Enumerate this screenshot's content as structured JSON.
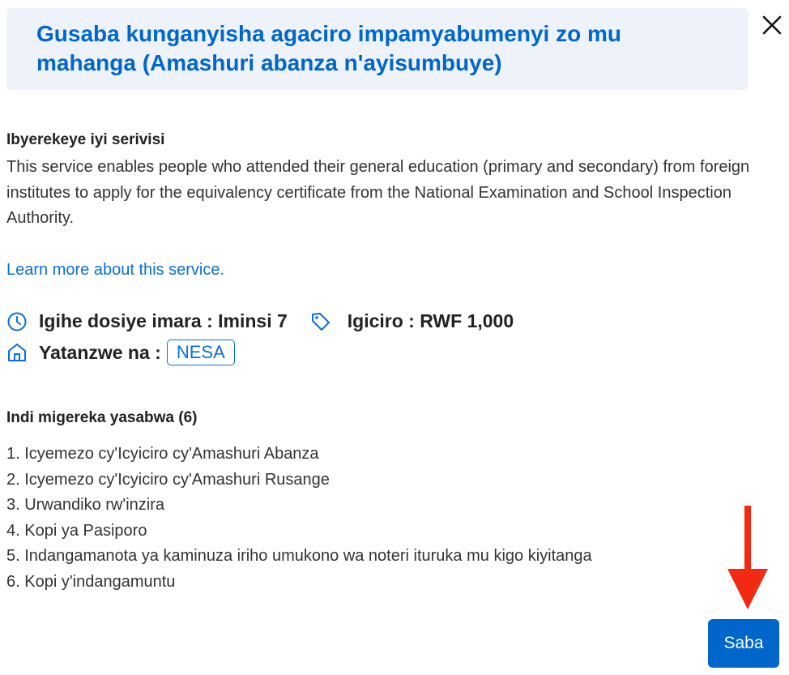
{
  "modal": {
    "title": "Gusaba kunganyisha agaciro impamyabumenyi zo mu mahanga (Amashuri abanza n'ayisumbuye)",
    "close_icon": "close-icon"
  },
  "description": {
    "heading": "Ibyerekeye iyi serivisi",
    "body": "This service enables people who attended their general education (primary and secondary) from foreign institutes to apply for the equivalency certificate from the National Examination and School Inspection Authority.",
    "learn_more": "Learn more about this service."
  },
  "meta": {
    "duration": {
      "icon": "clock-icon",
      "text": "Igihe dosiye imara : Iminsi 7"
    },
    "price": {
      "icon": "price-tag-icon",
      "text": "Igiciro : RWF 1,000"
    },
    "provider": {
      "icon": "home-icon",
      "label": "Yatanzwe na :",
      "badge": "NESA"
    }
  },
  "documents": {
    "heading": "Indi migereka yasabwa (6)",
    "items": [
      "1. Icyemezo cy'Icyiciro cy'Amashuri Abanza",
      "2. Icyemezo cy'Icyiciro cy'Amashuri Rusange",
      "3. Urwandiko rw'inzira",
      "4. Kopi ya Pasiporo",
      "5. Indangamanota ya kaminuza iriho umukono wa noteri ituruka mu kigo kiyitanga",
      "6. Kopi y'indangamuntu"
    ]
  },
  "actions": {
    "start_label": "Saba"
  },
  "annotation": {
    "arrow_icon": "down-arrow-icon",
    "arrow_color": "#f22a12"
  },
  "colors": {
    "accent": "#0066cc",
    "title_background": "#eef3fb",
    "link": "#0a6fd8"
  }
}
